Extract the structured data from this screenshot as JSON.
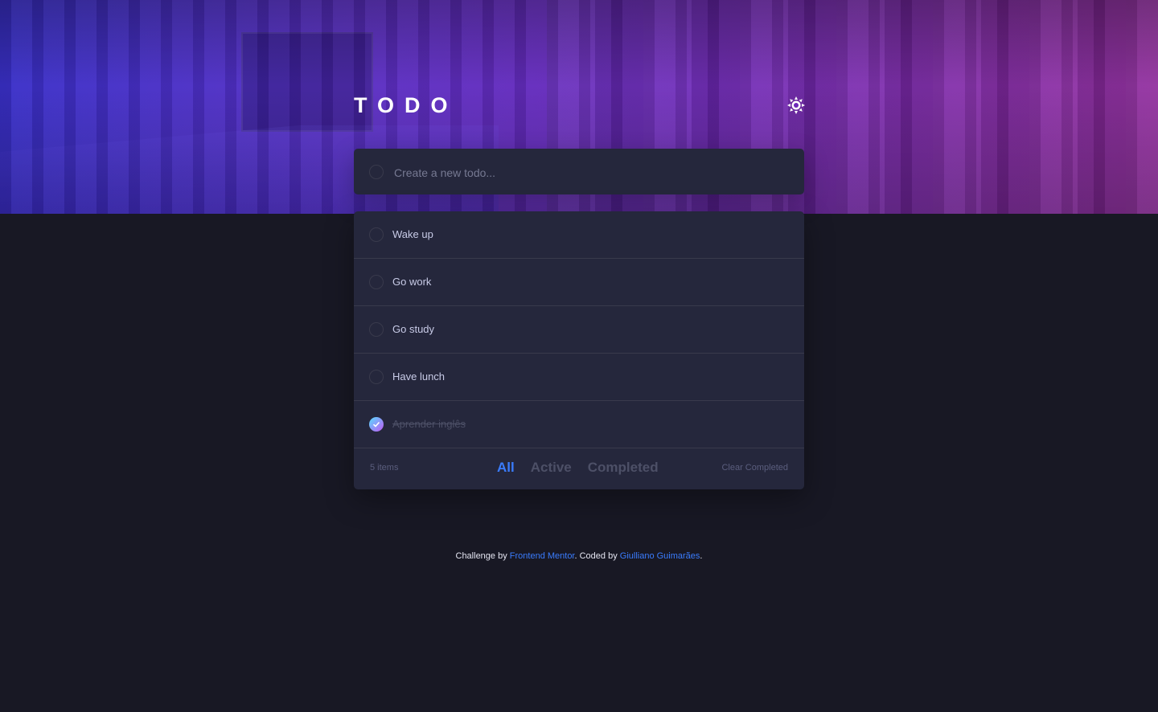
{
  "header": {
    "title": "TODO",
    "theme_toggle_icon": "sun-icon"
  },
  "new_todo": {
    "placeholder": "Create a new todo..."
  },
  "todos": [
    {
      "label": "Wake up",
      "completed": false
    },
    {
      "label": "Go work",
      "completed": false
    },
    {
      "label": "Go study",
      "completed": false
    },
    {
      "label": "Have lunch",
      "completed": false
    },
    {
      "label": "Aprender inglês",
      "completed": true
    }
  ],
  "footer": {
    "items_left": "5 items",
    "filters": [
      "All",
      "Active",
      "Completed"
    ],
    "active_filter": "All",
    "clear_label": "Clear Completed"
  },
  "attribution": {
    "prefix": "Challenge by ",
    "link1": "Frontend Mentor",
    "middle": ". Coded by ",
    "link2": "Giulliano Guimarães",
    "suffix": "."
  },
  "colors": {
    "background": "#181824",
    "card": "#25273c",
    "accent": "#3a7cfd",
    "text": "#c8cbe7",
    "muted": "#5b5e7e"
  }
}
